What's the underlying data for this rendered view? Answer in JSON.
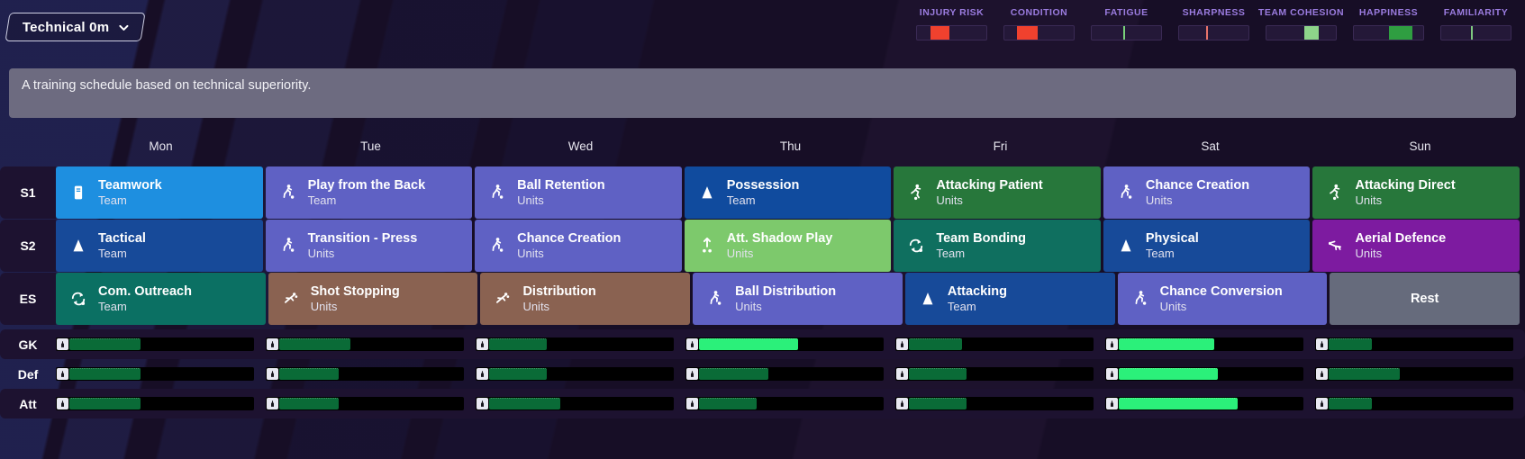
{
  "header": {
    "schedule_selector": {
      "label": "Technical 0m",
      "icon": "chevron-down-icon"
    },
    "meters": [
      {
        "name": "INJURY RISK",
        "fill_start_pct": 20,
        "fill_width_pct": 27,
        "color": "#f0412e"
      },
      {
        "name": "CONDITION",
        "fill_start_pct": 18,
        "fill_width_pct": 30,
        "color": "#f0412e"
      },
      {
        "name": "FATIGUE",
        "fill_start_pct": 46,
        "fill_width_pct": 2,
        "color": "#79d17a"
      },
      {
        "name": "SHARPNESS",
        "fill_start_pct": 39,
        "fill_width_pct": 3,
        "color": "#e8736a"
      },
      {
        "name": "TEAM COHESION",
        "fill_start_pct": 54,
        "fill_width_pct": 21,
        "color": "#8ed48a"
      },
      {
        "name": "HAPPINESS",
        "fill_start_pct": 50,
        "fill_width_pct": 34,
        "color": "#2f9e41"
      },
      {
        "name": "FAMILIARITY",
        "fill_start_pct": 43,
        "fill_width_pct": 2,
        "color": "#7ec97f"
      }
    ]
  },
  "description": "A training schedule based on technical superiority.",
  "days": [
    "Mon",
    "Tue",
    "Wed",
    "Thu",
    "Fri",
    "Sat",
    "Sun"
  ],
  "schedule_rows": [
    {
      "label": "S1",
      "sessions": [
        {
          "name": "Teamwork",
          "unit": "Team",
          "bg": "#1e8fe0",
          "icon": "clipboard-icon"
        },
        {
          "name": "Play from the Back",
          "unit": "Team",
          "bg": "#5f61c4",
          "icon": "player-ball-icon"
        },
        {
          "name": "Ball Retention",
          "unit": "Units",
          "bg": "#5f61c4",
          "icon": "player-ball-icon"
        },
        {
          "name": "Possession",
          "unit": "Team",
          "bg": "#104b9e",
          "icon": "cone-icon"
        },
        {
          "name": "Attacking Patient",
          "unit": "Units",
          "bg": "#27773b",
          "icon": "player-run-icon"
        },
        {
          "name": "Chance Creation",
          "unit": "Units",
          "bg": "#5f61c4",
          "icon": "player-ball-icon"
        },
        {
          "name": "Attacking Direct",
          "unit": "Units",
          "bg": "#27773b",
          "icon": "player-run-icon"
        }
      ]
    },
    {
      "label": "S2",
      "sessions": [
        {
          "name": "Tactical",
          "unit": "Team",
          "bg": "#174a99",
          "icon": "cone-icon"
        },
        {
          "name": "Transition - Press",
          "unit": "Units",
          "bg": "#5f61c4",
          "icon": "player-ball-icon"
        },
        {
          "name": "Chance Creation",
          "unit": "Units",
          "bg": "#5f61c4",
          "icon": "player-ball-icon"
        },
        {
          "name": "Att. Shadow Play",
          "unit": "Units",
          "bg": "#7dc96c",
          "icon": "shadow-play-icon"
        },
        {
          "name": "Team Bonding",
          "unit": "Team",
          "bg": "#0f6f5f",
          "icon": "bonding-icon"
        },
        {
          "name": "Physical",
          "unit": "Team",
          "bg": "#174a99",
          "icon": "cone-icon"
        },
        {
          "name": "Aerial Defence",
          "unit": "Units",
          "bg": "#7d1ba0",
          "icon": "diving-icon"
        }
      ]
    },
    {
      "label": "ES",
      "sessions": [
        {
          "name": "Com. Outreach",
          "unit": "Team",
          "bg": "#0b7063",
          "icon": "bonding-icon"
        },
        {
          "name": "Shot Stopping",
          "unit": "Units",
          "bg": "#8a6251",
          "icon": "keeper-dive-icon"
        },
        {
          "name": "Distribution",
          "unit": "Units",
          "bg": "#8a6251",
          "icon": "keeper-dive-icon"
        },
        {
          "name": "Ball Distribution",
          "unit": "Units",
          "bg": "#5f61c4",
          "icon": "player-ball-icon"
        },
        {
          "name": "Attacking",
          "unit": "Team",
          "bg": "#174a99",
          "icon": "cone-icon"
        },
        {
          "name": "Chance Conversion",
          "unit": "Units",
          "bg": "#5f61c4",
          "icon": "player-ball-icon"
        },
        {
          "name": "Rest",
          "unit": "",
          "bg": "#666b7c",
          "icon": "none"
        }
      ]
    }
  ],
  "intensity_rows": [
    {
      "label": "GK",
      "bars": [
        {
          "day": "Mon",
          "pct": 36,
          "color": "#0a6b37"
        },
        {
          "day": "Tue",
          "pct": 36,
          "color": "#0a6b37"
        },
        {
          "day": "Wed",
          "pct": 29,
          "color": "#0a6b37"
        },
        {
          "day": "Thu",
          "pct": 50,
          "color": "#2bf07a"
        },
        {
          "day": "Fri",
          "pct": 27,
          "color": "#0a6b37"
        },
        {
          "day": "Sat",
          "pct": 48,
          "color": "#2bf07a"
        },
        {
          "day": "Sun",
          "pct": 22,
          "color": "#0a6b37"
        }
      ]
    },
    {
      "label": "Def",
      "bars": [
        {
          "day": "Mon",
          "pct": 36,
          "color": "#0a6b37"
        },
        {
          "day": "Tue",
          "pct": 30,
          "color": "#0a6b37"
        },
        {
          "day": "Wed",
          "pct": 29,
          "color": "#0a6b37"
        },
        {
          "day": "Thu",
          "pct": 35,
          "color": "#0a6b37"
        },
        {
          "day": "Fri",
          "pct": 29,
          "color": "#0a6b37"
        },
        {
          "day": "Sat",
          "pct": 50,
          "color": "#2bf07a"
        },
        {
          "day": "Sun",
          "pct": 36,
          "color": "#0a6b37"
        }
      ]
    },
    {
      "label": "Att",
      "bars": [
        {
          "day": "Mon",
          "pct": 36,
          "color": "#0a6b37"
        },
        {
          "day": "Tue",
          "pct": 30,
          "color": "#0a6b37"
        },
        {
          "day": "Wed",
          "pct": 36,
          "color": "#0a6b37"
        },
        {
          "day": "Thu",
          "pct": 29,
          "color": "#0a6b37"
        },
        {
          "day": "Fri",
          "pct": 29,
          "color": "#0a6b37"
        },
        {
          "day": "Sat",
          "pct": 60,
          "color": "#2bf07a"
        },
        {
          "day": "Sun",
          "pct": 22,
          "color": "#0a6b37"
        }
      ]
    }
  ]
}
